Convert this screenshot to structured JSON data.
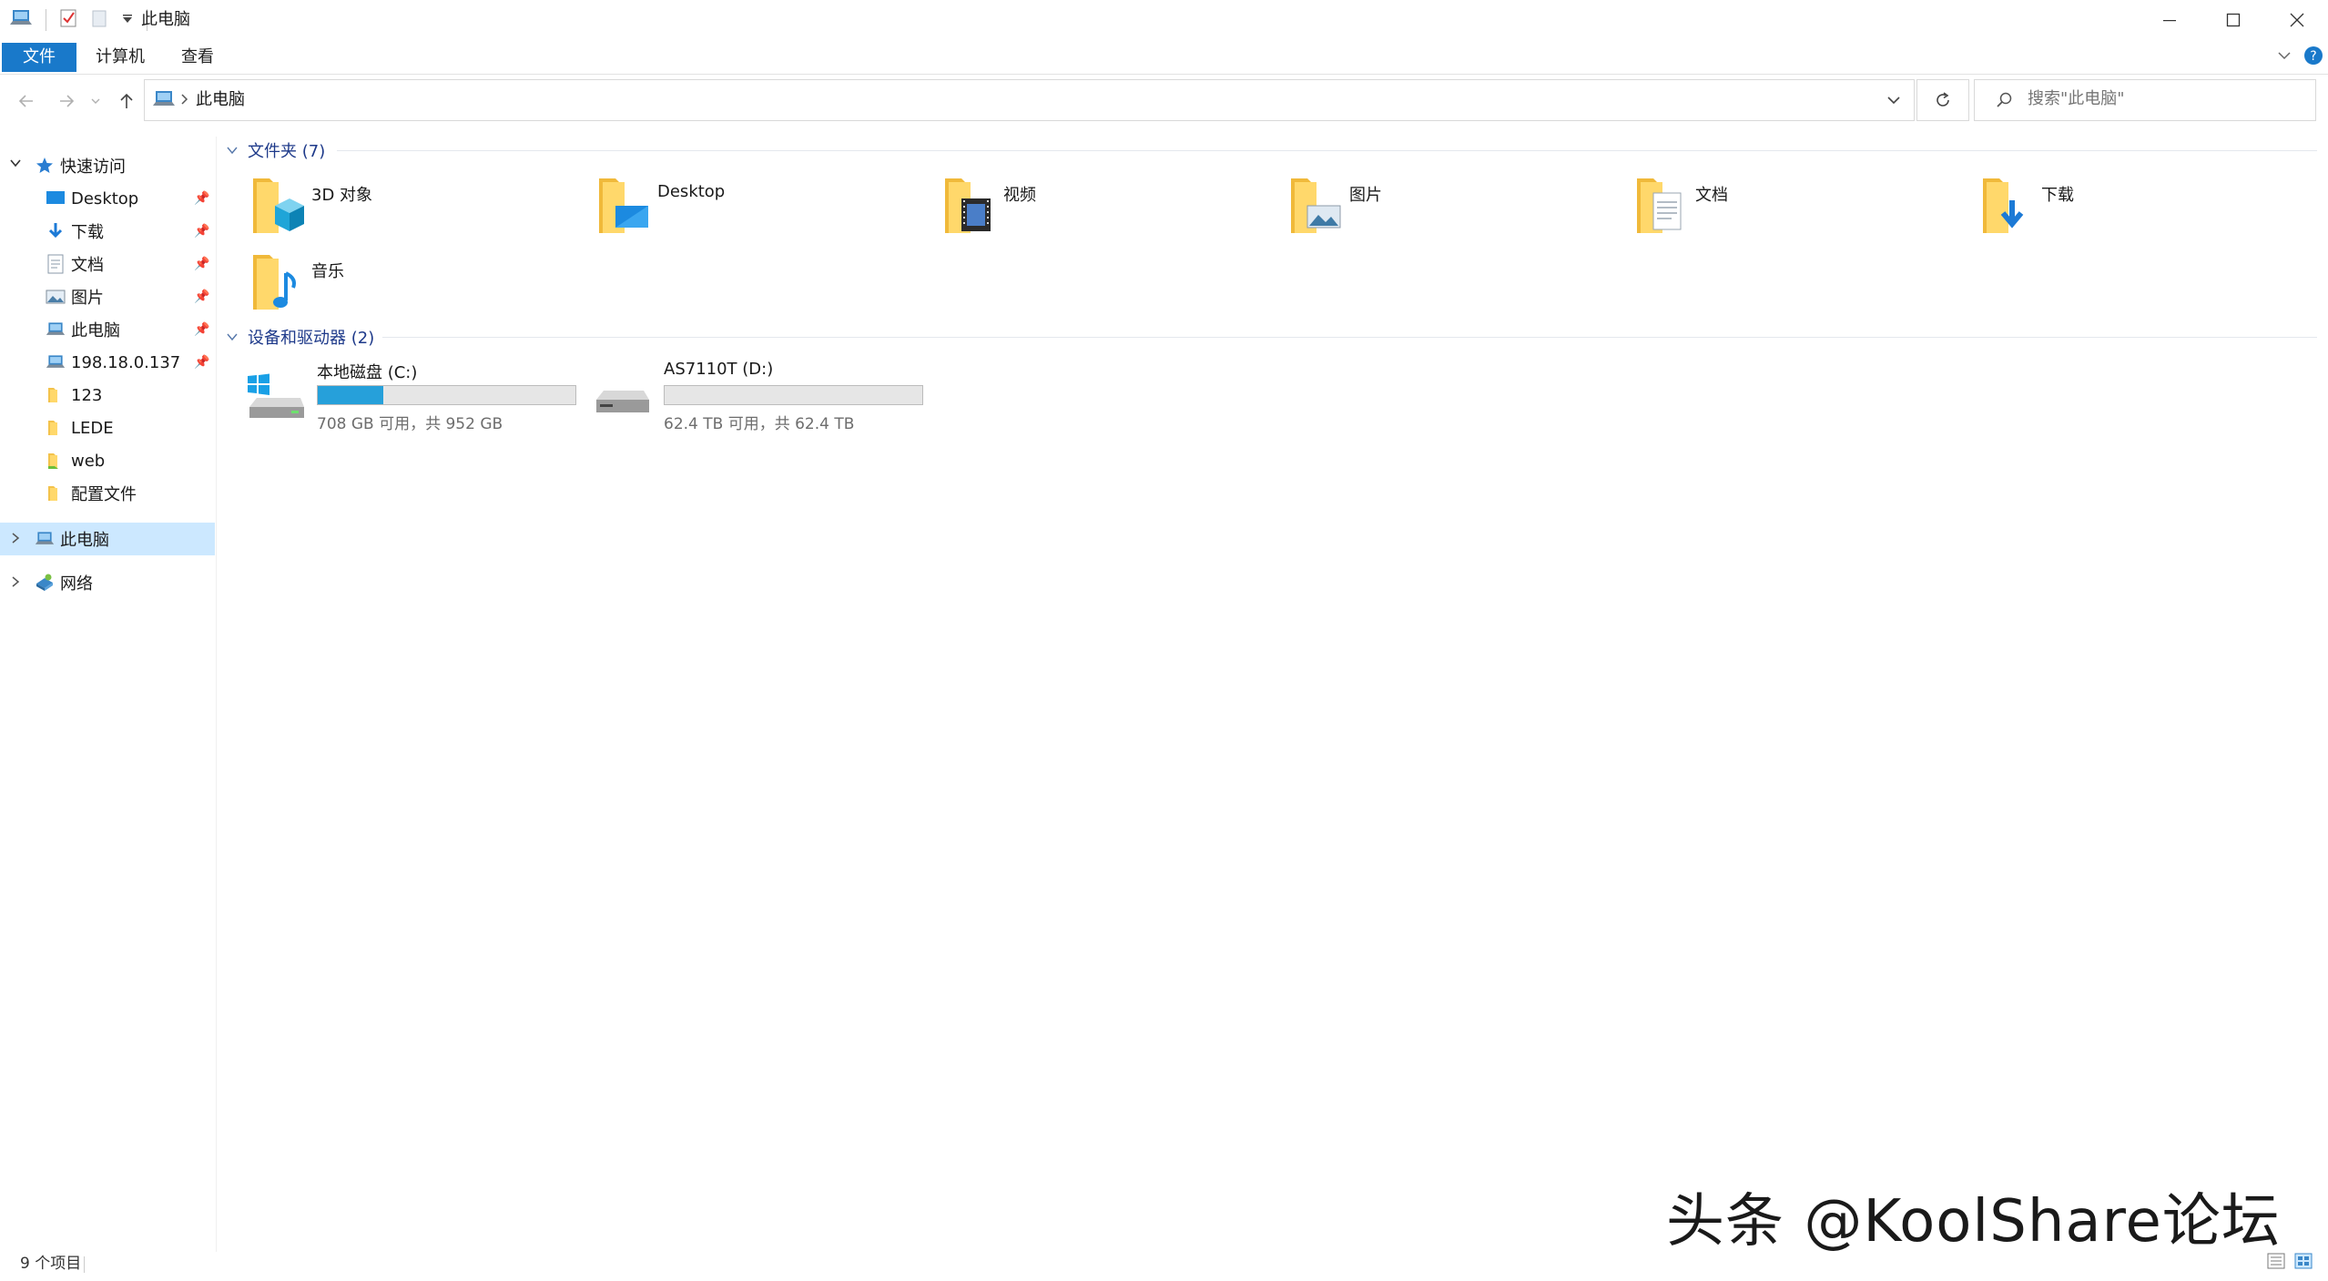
{
  "window": {
    "title": "此电脑"
  },
  "ribbon": {
    "tabs": [
      {
        "label": "文件",
        "active": true
      },
      {
        "label": "计算机",
        "active": false
      },
      {
        "label": "查看",
        "active": false
      }
    ]
  },
  "address": {
    "path": "此电脑"
  },
  "search": {
    "placeholder": "搜索\"此电脑\""
  },
  "sidebar": {
    "quick_access": "快速访问",
    "quick_items": [
      {
        "label": "Desktop",
        "icon": "desktop-icon",
        "pinned": true
      },
      {
        "label": "下载",
        "icon": "download-icon",
        "pinned": true
      },
      {
        "label": "文档",
        "icon": "document-icon",
        "pinned": true
      },
      {
        "label": "图片",
        "icon": "picture-icon",
        "pinned": true
      },
      {
        "label": "此电脑",
        "icon": "computer-icon",
        "pinned": true
      },
      {
        "label": "198.18.0.137",
        "icon": "network-computer-icon",
        "pinned": true
      },
      {
        "label": "123",
        "icon": "folder-icon",
        "pinned": false
      },
      {
        "label": "LEDE",
        "icon": "folder-icon",
        "pinned": false
      },
      {
        "label": "web",
        "icon": "folder-icon",
        "pinned": false
      },
      {
        "label": "配置文件",
        "icon": "folder-icon",
        "pinned": false
      }
    ],
    "this_pc": "此电脑",
    "network": "网络"
  },
  "main": {
    "folders_header": "文件夹 (7)",
    "folders": [
      {
        "label": "3D 对象",
        "icon": "3d-objects-folder-icon"
      },
      {
        "label": "Desktop",
        "icon": "desktop-folder-icon"
      },
      {
        "label": "视频",
        "icon": "videos-folder-icon"
      },
      {
        "label": "图片",
        "icon": "pictures-folder-icon"
      },
      {
        "label": "文档",
        "icon": "documents-folder-icon"
      },
      {
        "label": "下载",
        "icon": "downloads-folder-icon"
      },
      {
        "label": "音乐",
        "icon": "music-folder-icon"
      }
    ],
    "drives_header": "设备和驱动器 (2)",
    "drives": [
      {
        "name": "本地磁盘 (C:)",
        "space": "708 GB 可用，共 952 GB",
        "used_fraction": 0.256,
        "icon": "windows-drive-icon"
      },
      {
        "name": "AS7110T (D:)",
        "space": "62.4 TB 可用，共 62.4 TB",
        "used_fraction": 0.0,
        "icon": "network-drive-icon"
      }
    ]
  },
  "status": {
    "count": "9 个项目"
  },
  "watermark": "头条 @KoolShare论坛",
  "colors": {
    "accent": "#1979ca",
    "selection": "#cce8ff",
    "bar_fill": "#26a0da",
    "group_header": "#1e3a8a"
  }
}
